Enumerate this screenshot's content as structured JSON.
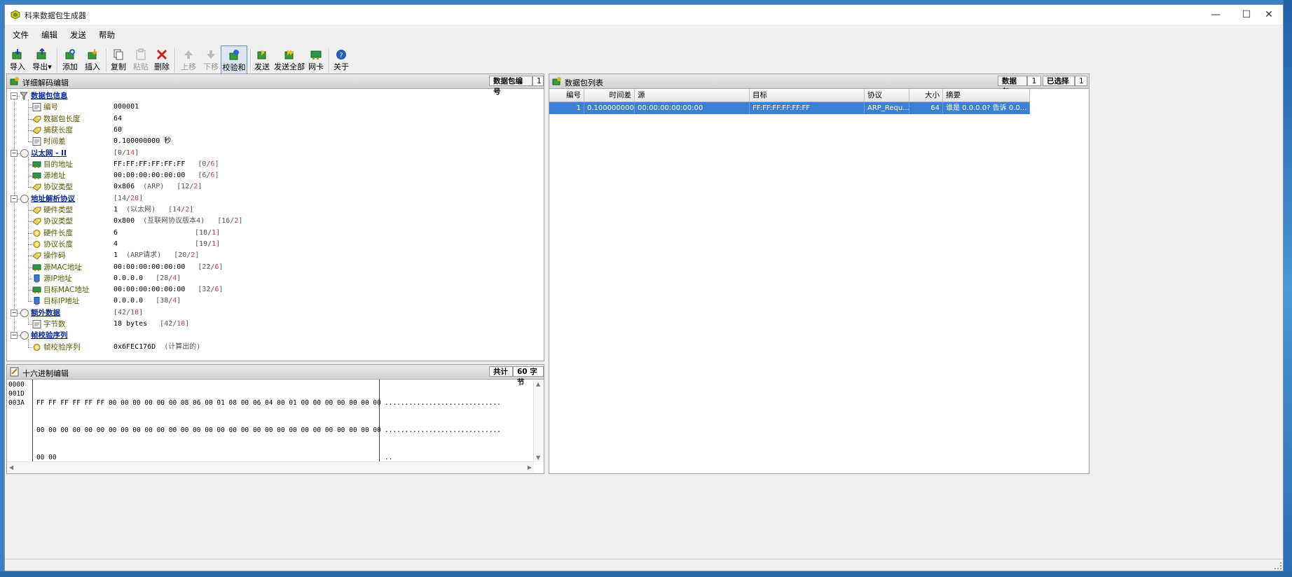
{
  "app": {
    "title": "科来数据包生成器",
    "min": "—",
    "max": "☐",
    "close": "✕"
  },
  "menu": [
    "文件",
    "编辑",
    "发送",
    "帮助"
  ],
  "toolbar": {
    "import": "导入",
    "export": "导出",
    "add": "添加",
    "insert": "插入",
    "copy": "复制",
    "paste": "粘贴",
    "delete": "删除",
    "up": "上移",
    "down": "下移",
    "checksum": "校验和",
    "send": "发送",
    "send_all": "发送全部",
    "nic": "网卡",
    "about": "关于"
  },
  "detail": {
    "title": "详细解码编辑",
    "pkt_no_label": "数据包编号",
    "pkt_no_value": "1",
    "sections": {
      "pktinfo": {
        "label": "数据包信息"
      },
      "eth": {
        "label": "以太网 - II",
        "range": "[0/14]"
      },
      "arp": {
        "label": "地址解析协议",
        "range": "[14/28]"
      },
      "extra": {
        "label": "额外数据",
        "range": "[42/18]"
      },
      "fcs": {
        "label": "帧校验序列"
      }
    },
    "fields": {
      "no": {
        "label": "编号",
        "value": "000001"
      },
      "pktlen": {
        "label": "数据包长度",
        "value": "64"
      },
      "caplen": {
        "label": "捕获长度",
        "value": "60"
      },
      "delta": {
        "label": "时间差",
        "value": "0.100000000 秒"
      },
      "dst": {
        "label": "目的地址",
        "value": "FF:FF:FF:FF:FF:FF",
        "range": "[0/6]"
      },
      "src": {
        "label": "源地址",
        "value": "00:00:00:00:00:00",
        "range": "[6/6]"
      },
      "ethtype": {
        "label": "协议类型",
        "value": "0x806",
        "note": "(ARP)",
        "range": "[12/2]"
      },
      "hwtype": {
        "label": "硬件类型",
        "value": "1",
        "note": "(以太网)",
        "range": "[14/2]"
      },
      "ptype": {
        "label": "协议类型",
        "value": "0x800",
        "note": "(互联网协议版本4)",
        "range": "[16/2]"
      },
      "hwlen": {
        "label": "硬件长度",
        "value": "6",
        "range": "[18/1]"
      },
      "plen": {
        "label": "协议长度",
        "value": "4",
        "range": "[19/1]"
      },
      "op": {
        "label": "操作码",
        "value": "1",
        "note": "(ARP请求)",
        "range": "[20/2]"
      },
      "smac": {
        "label": "源MAC地址",
        "value": "00:00:00:00:00:00",
        "range": "[22/6]"
      },
      "sip": {
        "label": "源IP地址",
        "value": "0.0.0.0",
        "range": "[28/4]"
      },
      "tmac": {
        "label": "目标MAC地址",
        "value": "00:00:00:00:00:00",
        "range": "[32/6]"
      },
      "tip": {
        "label": "目标IP地址",
        "value": "0.0.0.0",
        "range": "[38/4]"
      },
      "bytes": {
        "label": "字节数",
        "value": "18 bytes",
        "range": "[42/18]"
      },
      "fcsval": {
        "label": "帧校验序列",
        "value": "0x6FEC176D",
        "note": "(计算出的)"
      }
    }
  },
  "hex": {
    "title": "十六进制编辑",
    "total_label": "共计",
    "total_value": "60 字节",
    "offsets": [
      "0000",
      "001D",
      "003A"
    ],
    "rows": [
      "FF FF FF FF FF FF 00 00 00 00 00 00 08 06 00 01 08 00 06 04 00 01 00 00 00 00 00 00 00",
      "00 00 00 00 00 00 00 00 00 00 00 00 00 00 00 00 00 00 00 00 00 00 00 00 00 00 00 00 00",
      "00 00"
    ],
    "ascii": [
      ".............................",
      ".............................",
      ".."
    ]
  },
  "list": {
    "title": "数据包列表",
    "packets_label": "数据包",
    "packets_value": "1",
    "selected_label": "已选择",
    "selected_value": "1",
    "columns": [
      "编号",
      "时间差",
      "源",
      "目标",
      "协议",
      "大小",
      "摘要"
    ],
    "rows": [
      {
        "no": "1",
        "delta": "0.100000000",
        "src": "00:00:00:00:00:00",
        "dst": "FF:FF:FF:FF:FF:FF",
        "proto": "ARP_Requ...",
        "size": "64",
        "summary": "谁是 0.0.0.0? 告诉 0.0..."
      }
    ]
  }
}
